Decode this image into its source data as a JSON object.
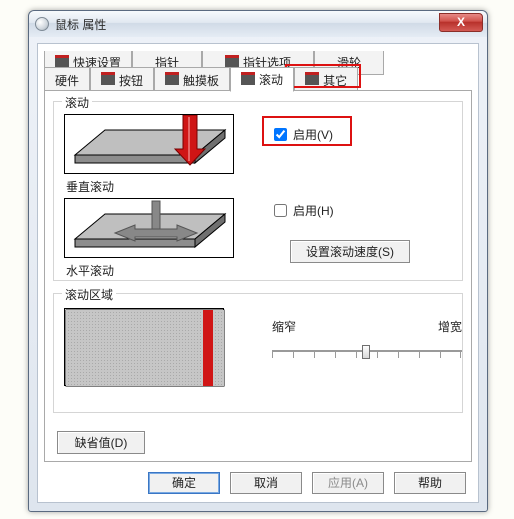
{
  "window": {
    "title": "鼠标 属性"
  },
  "close_glyph": "X",
  "tabs_row1": [
    {
      "label": "快速设置"
    },
    {
      "label": "指针"
    },
    {
      "label": "指针选项"
    },
    {
      "label": "滑轮"
    }
  ],
  "tabs_row2": [
    {
      "label": "硬件"
    },
    {
      "label": "按钮"
    },
    {
      "label": "触摸板"
    },
    {
      "label": "滚动"
    },
    {
      "label": "其它"
    }
  ],
  "group_scroll": {
    "title": "滚动",
    "vertical_caption": "垂直滚动",
    "vertical_enable": "启用(V)",
    "horizontal_caption": "水平滚动",
    "horizontal_enable": "启用(H)",
    "speed_button": "设置滚动速度(S)"
  },
  "group_zone": {
    "title": "滚动区域",
    "narrow": "缩窄",
    "widen": "增宽",
    "slider_value": 0.5
  },
  "defaults_button": "缺省值(D)",
  "footer": {
    "ok": "确定",
    "cancel": "取消",
    "apply": "应用(A)",
    "help": "帮助"
  }
}
